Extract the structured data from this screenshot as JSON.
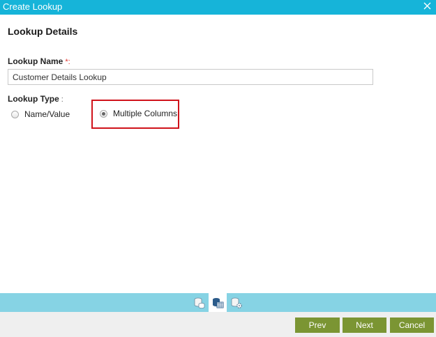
{
  "window": {
    "title": "Create Lookup",
    "close_icon": "close-icon"
  },
  "section": {
    "title": "Lookup Details"
  },
  "lookup_name": {
    "label": "Lookup Name",
    "required_mark": "*",
    "colon": ":",
    "value": "Customer Details Lookup"
  },
  "lookup_type": {
    "label": "Lookup Type",
    "colon": ":",
    "options": [
      {
        "label": "Name/Value",
        "checked": false
      },
      {
        "label": "Multiple Columns",
        "checked": true
      }
    ]
  },
  "steps": [
    {
      "icon": "database-stack-icon",
      "active": false
    },
    {
      "icon": "database-table-icon",
      "active": true
    },
    {
      "icon": "database-settings-icon",
      "active": false
    }
  ],
  "footer": {
    "prev_label": "Prev",
    "next_label": "Next",
    "cancel_label": "Cancel"
  },
  "colors": {
    "titlebar": "#16b4d9",
    "stepbar": "#86d3e4",
    "button": "#7b9533",
    "highlight": "#d0121a",
    "required": "#e0322c"
  }
}
